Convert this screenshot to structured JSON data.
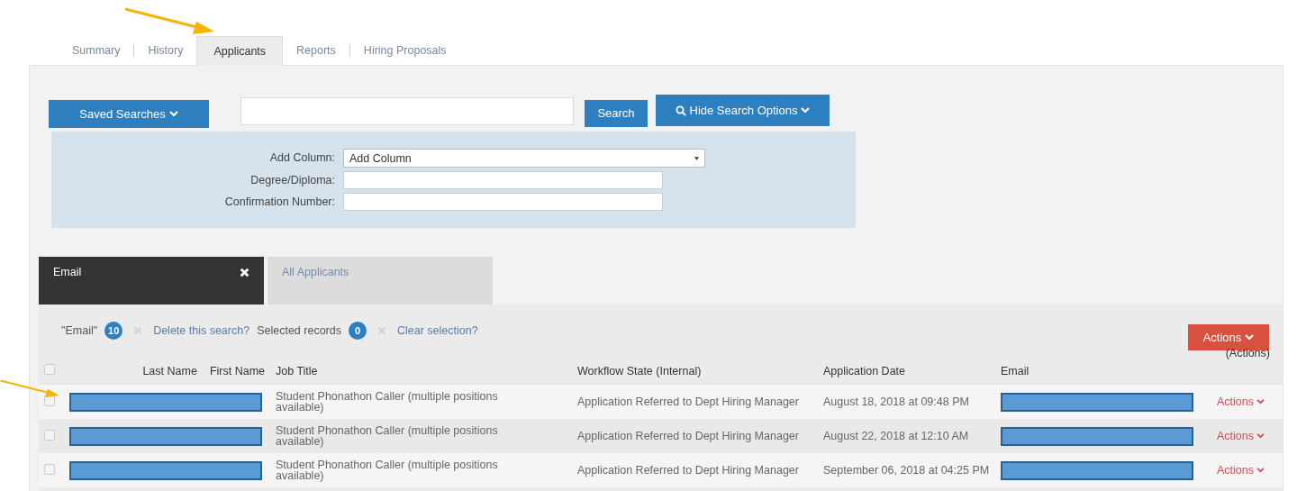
{
  "tabs": [
    {
      "label": "Summary",
      "selected": false
    },
    {
      "label": "History",
      "selected": false
    },
    {
      "label": "Applicants",
      "selected": true
    },
    {
      "label": "Reports",
      "selected": false
    },
    {
      "label": "Hiring Proposals",
      "selected": false
    }
  ],
  "toolbar": {
    "saved_searches": "Saved Searches",
    "search_button": "Search",
    "hide_options": "Hide Search Options"
  },
  "search_options": [
    {
      "kind": "select",
      "label": "Add Column:",
      "value": "Add Column"
    },
    {
      "kind": "text",
      "label": "Degree/Diploma:"
    },
    {
      "kind": "text",
      "label": "Confirmation Number:"
    }
  ],
  "saved_search_tabs": [
    {
      "label": "Email",
      "selected": true
    },
    {
      "label": "All Applicants",
      "selected": false
    }
  ],
  "filter_bar": {
    "search_name": "\"Email\"",
    "result_count": "10",
    "delete_link": "Delete this search?",
    "selected_label": "Selected records",
    "selected_count": "0",
    "clear_link": "Clear selection?",
    "actions_button": "Actions"
  },
  "table": {
    "select_all_checked": false,
    "columns": [
      "Last Name",
      "First Name",
      "Job Title",
      "Workflow State (Internal)",
      "Application Date",
      "Email",
      "(Actions)"
    ],
    "rows": [
      {
        "checked": false,
        "job_title": "Student Phonathon Caller (multiple positions available)",
        "workflow_state": "Application Referred to Dept Hiring Manager",
        "application_date": "August 18, 2018 at 09:48 PM",
        "actions": "Actions"
      },
      {
        "checked": false,
        "job_title": "Student Phonathon Caller (multiple positions available)",
        "workflow_state": "Application Referred to Dept Hiring Manager",
        "application_date": "August 22, 2018 at 12:10 AM",
        "actions": "Actions"
      },
      {
        "checked": false,
        "job_title": "Student Phonathon Caller (multiple positions available)",
        "workflow_state": "Application Referred to Dept Hiring Manager",
        "application_date": "September 06, 2018 at 04:25 PM",
        "actions": "Actions"
      }
    ]
  }
}
